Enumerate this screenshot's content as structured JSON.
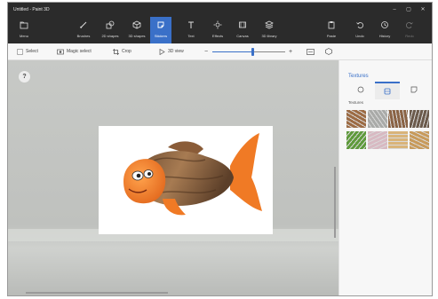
{
  "window": {
    "title": "Untitled - Paint 3D",
    "minimize": "–",
    "maximize": "▢",
    "close": "✕"
  },
  "ribbon": {
    "menu_label": "Menu",
    "brushes_label": "Brushes",
    "shapes2d_label": "2D shapes",
    "shapes3d_label": "3D shapes",
    "stickers_label": "Stickers",
    "text_label": "Text",
    "effects_label": "Effects",
    "canvas_label": "Canvas",
    "library3d_label": "3D library",
    "paste_label": "Paste",
    "undo_label": "Undo",
    "history_label": "History",
    "redo_label": "Redo"
  },
  "toolbar": {
    "select_label": "Select",
    "magic_select_label": "Magic select",
    "crop_label": "Crop",
    "view3d_label": "3D view",
    "zoom_percent": 55
  },
  "panel": {
    "title": "Textures",
    "section_label": "Textures",
    "textures": [
      {
        "name": "wood-bark",
        "color": "#9c6b44"
      },
      {
        "name": "grey-stone",
        "color": "#a9aaa8"
      },
      {
        "name": "brown-fur",
        "color": "#8a6345"
      },
      {
        "name": "pebbles",
        "color": "#6b5a4c"
      },
      {
        "name": "green-leaves",
        "color": "#5e9a3b"
      },
      {
        "name": "pink-marble",
        "color": "#d8b9c2"
      },
      {
        "name": "light-wood",
        "color": "#d9b47a"
      },
      {
        "name": "oak-wood",
        "color": "#c89a5a"
      }
    ]
  },
  "colors": {
    "accent": "#3a70c8",
    "ribbon_bg": "#2b2b2b"
  }
}
